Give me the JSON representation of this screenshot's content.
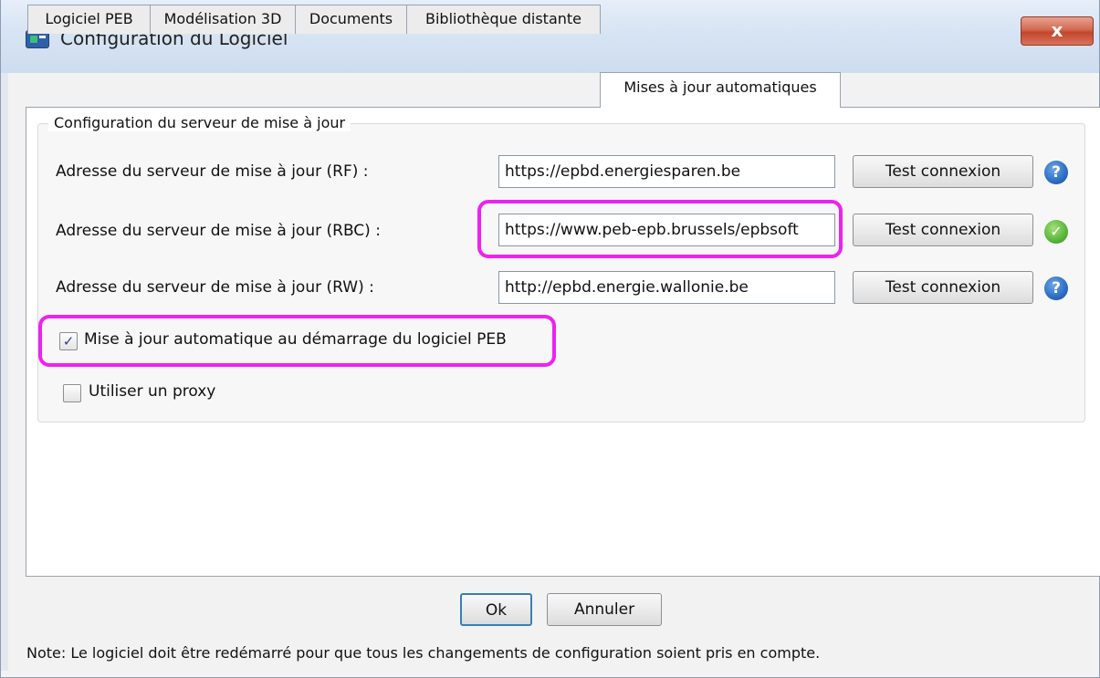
{
  "window": {
    "title": "Configuration du Logiciel",
    "close_label": "x"
  },
  "tabs": [
    {
      "label": "Logiciel PEB"
    },
    {
      "label": "Modélisation 3D"
    },
    {
      "label": "Documents"
    },
    {
      "label": "Bibliothèque distante"
    },
    {
      "label": "Mises à jour automatiques",
      "active": true
    }
  ],
  "group": {
    "title": "Configuration du serveur de mise à jour"
  },
  "servers": [
    {
      "label": "Adresse du serveur de mise à jour (RF) :",
      "value": "https://epbd.energiesparen.be",
      "button": "Test connexion",
      "status_icon": "help-icon",
      "status_symbol": "?"
    },
    {
      "label": "Adresse du serveur de mise à jour (RBC) :",
      "value": "https://www.peb-epb.brussels/epbsoft",
      "button": "Test connexion",
      "status_icon": "success-check-icon",
      "status_symbol": "✓"
    },
    {
      "label": "Adresse du serveur de mise à jour (RW) :",
      "value": "http://epbd.energie.wallonie.be",
      "button": "Test connexion",
      "status_icon": "help-icon",
      "status_symbol": "?"
    }
  ],
  "options": {
    "auto_update": {
      "label": "Mise à jour automatique au démarrage du logiciel PEB",
      "checked": true,
      "mark": "✓"
    },
    "use_proxy": {
      "label": "Utiliser un proxy",
      "checked": false,
      "mark": ""
    }
  },
  "footer": {
    "ok_label": "Ok",
    "cancel_label": "Annuler",
    "note": "Note: Le logiciel doit être redémarré pour que tous les changements de configuration soient pris en compte."
  },
  "colors": {
    "highlight": "#ee22ee",
    "close_button": "#c2462c"
  }
}
